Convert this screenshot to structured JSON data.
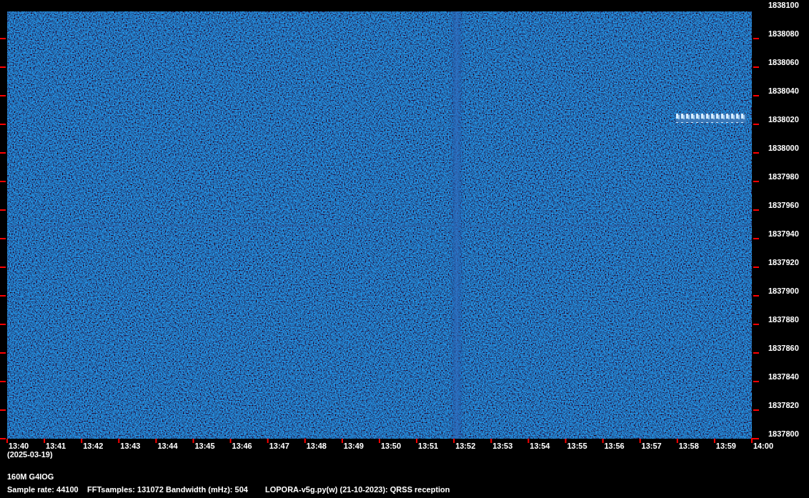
{
  "frequency_labels": [
    "1838100",
    "1838080",
    "1838060",
    "1838040",
    "1838020",
    "1838000",
    "1837980",
    "1837960",
    "1837940",
    "1837920",
    "1837900",
    "1837880",
    "1837860",
    "1837840",
    "1837820",
    "1837800"
  ],
  "time_labels": [
    "13:40",
    "13:41",
    "13:42",
    "13:43",
    "13:44",
    "13:45",
    "13:46",
    "13:47",
    "13:48",
    "13:49",
    "13:50",
    "13:51",
    "13:52",
    "13:53",
    "13:54",
    "13:55",
    "13:56",
    "13:57",
    "13:58",
    "13:59",
    "14:00"
  ],
  "date": "(2025-03-19)",
  "station": "160M G4IOG",
  "info": [
    "Sample rate: 44100",
    "FFTsamples: 131072",
    "Bandwidth (mHz): 504",
    "LOPORA-v5g.py(w) (21-10-2023): QRSS reception"
  ]
}
